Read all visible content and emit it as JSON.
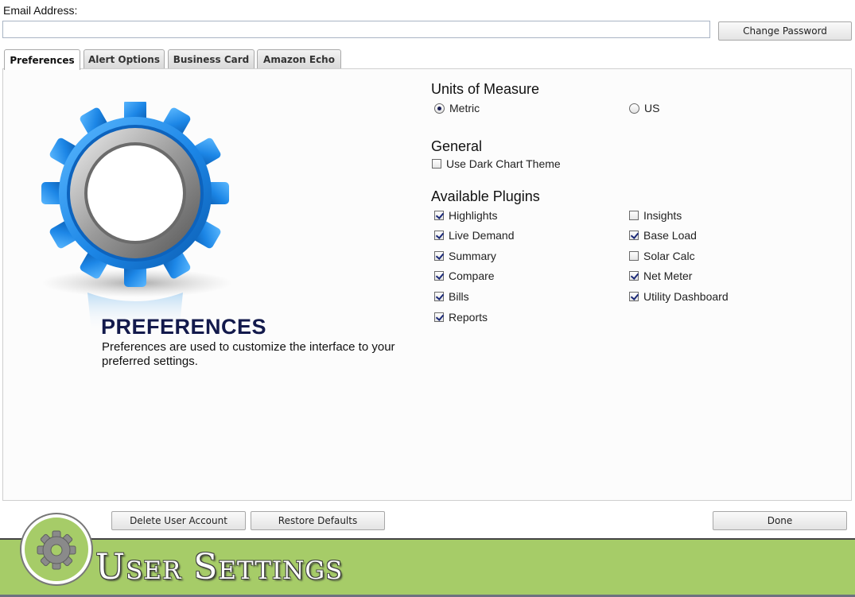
{
  "header": {
    "email_label": "Email Address:",
    "email_value": "",
    "change_password_label": "Change Password"
  },
  "tabs": [
    {
      "label": "Preferences",
      "active": true
    },
    {
      "label": "Alert Options",
      "active": false
    },
    {
      "label": "Business Card",
      "active": false
    },
    {
      "label": "Amazon Echo",
      "active": false
    }
  ],
  "hero": {
    "icon": "gear-icon",
    "title": "PREFERENCES",
    "description": "Preferences are used to customize the interface to your preferred settings."
  },
  "units": {
    "heading": "Units of Measure",
    "options": [
      {
        "label": "Metric",
        "selected": true
      },
      {
        "label": "US",
        "selected": false
      }
    ]
  },
  "general": {
    "heading": "General",
    "dark_chart_label": "Use Dark Chart Theme",
    "dark_chart_checked": false
  },
  "plugins": {
    "heading": "Available Plugins",
    "left": [
      {
        "label": "Highlights",
        "checked": true
      },
      {
        "label": "Live Demand",
        "checked": true
      },
      {
        "label": "Summary",
        "checked": true
      },
      {
        "label": "Compare",
        "checked": true
      },
      {
        "label": "Bills",
        "checked": true
      },
      {
        "label": "Reports",
        "checked": true
      }
    ],
    "right": [
      {
        "label": "Insights",
        "checked": false
      },
      {
        "label": "Base Load",
        "checked": true
      },
      {
        "label": "Solar Calc",
        "checked": false
      },
      {
        "label": "Net Meter",
        "checked": true
      },
      {
        "label": "Utility Dashboard",
        "checked": true
      }
    ]
  },
  "buttons": {
    "delete_account": "Delete User Account",
    "restore_defaults": "Restore Defaults",
    "done": "Done"
  },
  "footer": {
    "title": "User Settings",
    "logo_icon": "gear-icon",
    "band_color": "#a6cc68"
  }
}
